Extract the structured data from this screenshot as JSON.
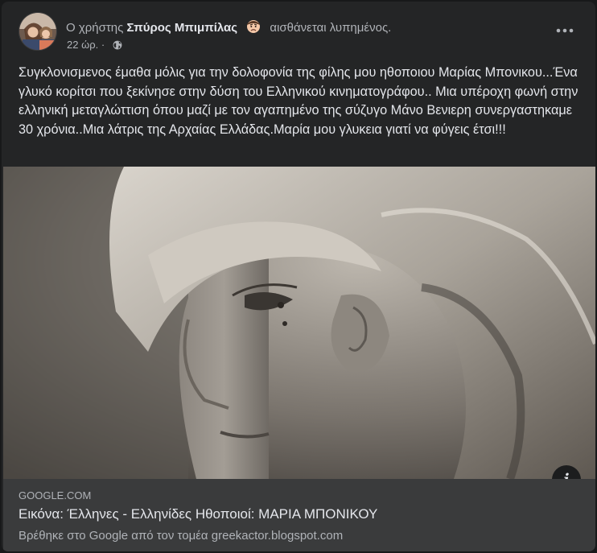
{
  "post": {
    "author_prefix": "Ο χρήστης",
    "author_name": "Σπύρος Μπιμπίλας",
    "feeling_text": "αισθάνεται λυπημένος.",
    "timestamp": "22 ώρ. ·",
    "privacy_icon": "globe-icon",
    "feeling_icon": "sad-face-icon",
    "more_icon": "more-options-icon",
    "text": "Συγκλονισμενος έμαθα μόλις για την δολοφονία της φίλης μου  ηθοποιου Μαρίας Μπονικου...Ένα γλυκό κορίτσι που ξεκίνησε στην δύση του Ελληνικού κινηματογράφου.. Μια υπέροχη φωνή στην ελληνική μεταγλώττιση όπου μαζί με τον αγαπημένο της σύζυγο Μάνο Βενιερη συνεργαστηκαμε 30 χρόνια..Μια λάτρις της Αρχαίας Ελλάδας.Μαρία μου γλυκεια γιατί  να φύγεις έτσι!!!"
  },
  "link_preview": {
    "domain": "GOOGLE.COM",
    "title": "Εικόνα: Έλληνες - Ελληνίδες Ηθοποιοί: ΜΑΡΙΑ ΜΠΟΝΙΚΟΥ",
    "description": "Βρέθηκε στο Google από τον τομέα greekactor.blogspot.com",
    "info_icon": "info-icon",
    "info_label": "i"
  },
  "colors": {
    "background": "#18191a",
    "card": "#242526",
    "link_box": "#3a3b3c",
    "primary_text": "#e4e6eb",
    "secondary_text": "#b0b3b8"
  }
}
